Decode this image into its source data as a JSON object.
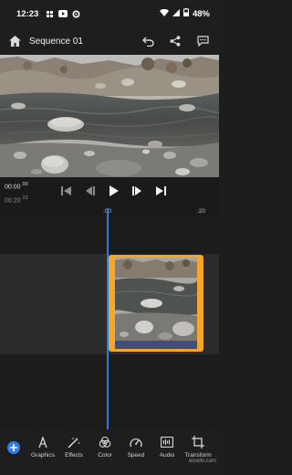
{
  "status": {
    "time": "12:23",
    "battery": "48%",
    "icons": [
      "grid-icon",
      "youtube-icon",
      "settings-icon",
      "wifi-icon",
      "signal-icon",
      "battery-icon"
    ]
  },
  "header": {
    "title": "Sequence 01",
    "icons": [
      "home-icon",
      "undo-icon",
      "share-icon",
      "comments-icon"
    ]
  },
  "playback": {
    "current_time": "00:00",
    "current_frames": "00",
    "total_time": "00:20",
    "total_frames": "23",
    "controls": [
      "skip-to-start-icon",
      "step-back-icon",
      "play-icon",
      "step-forward-icon",
      "skip-to-end-icon"
    ]
  },
  "ruler": {
    "ticks": [
      ":00",
      ":20"
    ]
  },
  "toolbar": {
    "add_icon": "plus-icon",
    "tools": [
      {
        "label": "Graphics",
        "icon": "graphics-icon"
      },
      {
        "label": "Effects",
        "icon": "effects-icon"
      },
      {
        "label": "Color",
        "icon": "color-icon"
      },
      {
        "label": "Speed",
        "icon": "speed-icon"
      },
      {
        "label": "Audio",
        "icon": "audio-icon"
      },
      {
        "label": "Transform",
        "icon": "transform-icon"
      }
    ]
  },
  "watermark": "wsxdn.com",
  "colors": {
    "accent_blue": "#2c7bdf",
    "clip_border": "#f4a52a",
    "background": "#1d1d1d"
  }
}
